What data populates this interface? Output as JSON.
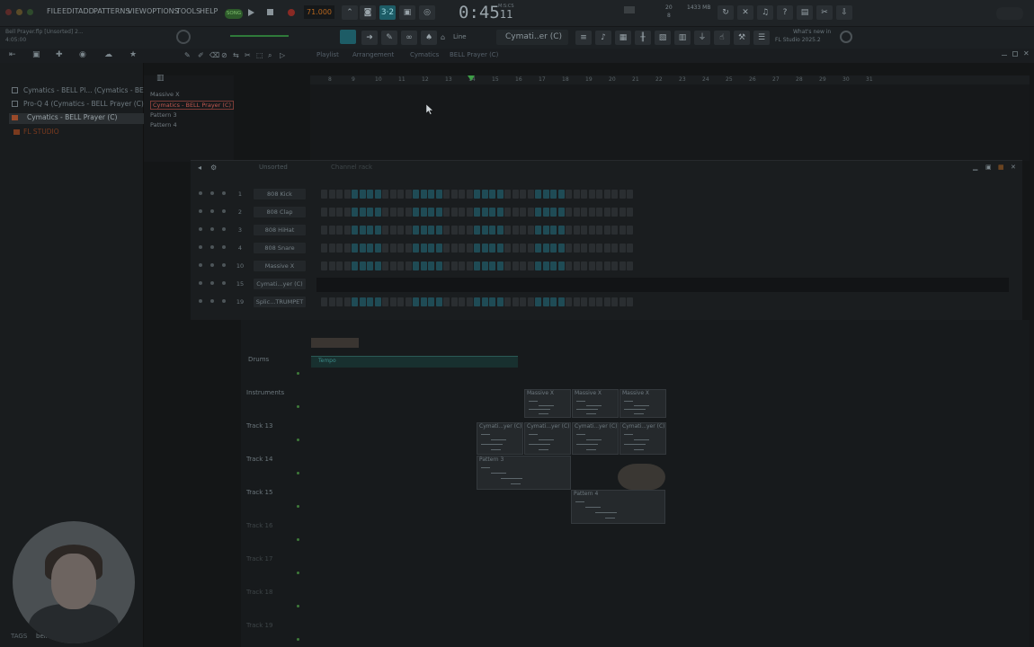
{
  "menu": [
    "FILE",
    "EDIT",
    "ADD",
    "PATTERNS",
    "VIEW",
    "OPTIONS",
    "TOOLS",
    "HELP"
  ],
  "transport": {
    "tempo": "71.000",
    "pat_label": "PAT",
    "song_label": "SONG",
    "clock": "0:45",
    "clock_frac": "11",
    "clock_unit": "M:S:CS"
  },
  "monitor": {
    "cpu": "20",
    "ram": "1433 MB",
    "voices": "8"
  },
  "news": {
    "line1": "What's new in",
    "line2": "FL Studio 2025.2"
  },
  "hint": {
    "line1": "Bell Prayer.flp [Unsorted] 2...",
    "line2": "4:05:00"
  },
  "toolbar2": {
    "snap": "Line",
    "pattern": "Cymati..er (C)"
  },
  "breadcrumb": [
    "Playlist",
    "Arrangement",
    "Cymatics",
    "BELL Prayer (C)"
  ],
  "browser": {
    "items": [
      {
        "label": "Cymatics - BELL Pl... (Cymatics - BELL Pr...",
        "selected": false
      },
      {
        "label": "Pro-Q 4 (Cymatics - BELL Prayer (C))",
        "selected": false
      },
      {
        "label": "Cymatics - BELL Prayer (C)",
        "selected": true
      },
      {
        "label": "FL STUDIO",
        "selected": false
      }
    ],
    "tags_label": "TAGS",
    "tag_value": "bell"
  },
  "picker": {
    "items": [
      {
        "label": "Massive X",
        "selected": false
      },
      {
        "label": "Cymatics - BELL Prayer (C)",
        "selected": true
      },
      {
        "label": "Pattern 3",
        "selected": false
      },
      {
        "label": "Pattern 4",
        "selected": false
      }
    ]
  },
  "ruler": [
    "8",
    "9",
    "10",
    "11",
    "12",
    "13",
    "14",
    "15",
    "16",
    "17",
    "18",
    "19",
    "20",
    "21",
    "22",
    "23",
    "24",
    "25",
    "26",
    "27",
    "28",
    "29",
    "30",
    "31"
  ],
  "rack": {
    "title": "Channel rack",
    "filter": "Unsorted",
    "channels": [
      {
        "num": "1",
        "name": "808 Kick"
      },
      {
        "num": "2",
        "name": "808 Clap"
      },
      {
        "num": "3",
        "name": "808 HiHat"
      },
      {
        "num": "4",
        "name": "808 Snare"
      },
      {
        "num": "10",
        "name": "Massive X"
      },
      {
        "num": "15",
        "name": "Cymati...yer (C)"
      },
      {
        "num": "19",
        "name": "Splic...TRUMPET"
      }
    ]
  },
  "playlist": {
    "tracks": [
      {
        "name": "Drums",
        "dim": false
      },
      {
        "name": "Instruments",
        "dim": false
      },
      {
        "name": "Track 13",
        "dim": false
      },
      {
        "name": "Track 14",
        "dim": false
      },
      {
        "name": "Track 15",
        "dim": false
      },
      {
        "name": "Track 16",
        "dim": true
      },
      {
        "name": "Track 17",
        "dim": true
      },
      {
        "name": "Track 18",
        "dim": true
      },
      {
        "name": "Track 19",
        "dim": true
      }
    ],
    "tempo_clip": "Tempo",
    "clips": [
      {
        "label": "Massive X"
      },
      {
        "label": "Massive X"
      },
      {
        "label": "Massive X"
      },
      {
        "label": "Cymati...yer (C)"
      },
      {
        "label": "Cymati...yer (C)"
      },
      {
        "label": "Cymati...yer (C)"
      },
      {
        "label": "Cymati...yer (C)"
      },
      {
        "label": "Pattern 3"
      },
      {
        "label": "Pattern 4"
      }
    ]
  },
  "colors": {
    "accent": "#21a9b8",
    "step_on": "#1f4b55",
    "record": "#c0392b",
    "selection": "#c0574f"
  }
}
